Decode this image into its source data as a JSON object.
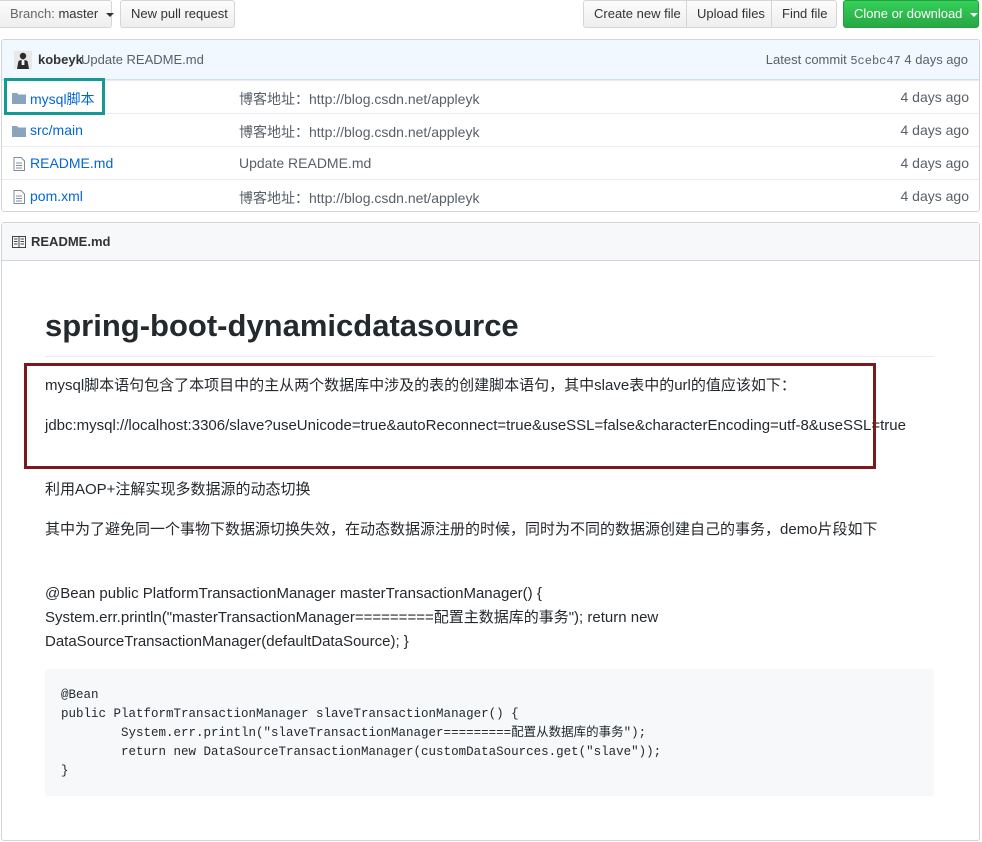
{
  "toolbar": {
    "branch_prefix": "Branch:",
    "branch_name": "master",
    "new_pull_request": "New pull request",
    "create_new_file": "Create new file",
    "upload_files": "Upload files",
    "find_file": "Find file",
    "clone_or_download": "Clone or download"
  },
  "commit": {
    "author": "kobeyk",
    "message": "Update README.md",
    "latest_label": "Latest commit",
    "sha": "5cebc47",
    "age": "4 days ago"
  },
  "files": [
    {
      "name": "mysql脚本",
      "type": "folder",
      "message": "博客地址：http://blog.csdn.net/appleyk",
      "age": "4 days ago"
    },
    {
      "name": "src/main",
      "type": "folder",
      "message": "博客地址：http://blog.csdn.net/appleyk",
      "age": "4 days ago"
    },
    {
      "name": "README.md",
      "type": "file",
      "message": "Update README.md",
      "age": "4 days ago"
    },
    {
      "name": "pom.xml",
      "type": "file",
      "message": "博客地址：http://blog.csdn.net/appleyk",
      "age": "4 days ago"
    }
  ],
  "readme": {
    "header": "README.md",
    "title": "spring-boot-dynamicdatasource",
    "p1": "mysql脚本语句包含了本项目中的主从两个数据库中涉及的表的创建脚本语句，其中slave表中的url的值应该如下：",
    "p2": "jdbc:mysql://localhost:3306/slave?useUnicode=true&autoReconnect=true&useSSL=false&characterEncoding=utf-8&useSSL=true",
    "p3": "利用AOP+注解实现多数据源的动态切换",
    "p4": "其中为了避免同一个事物下数据源切换失效，在动态数据源注册的时候，同时为不同的数据源创建自己的事务，demo片段如下",
    "p5": "@Bean public PlatformTransactionManager masterTransactionManager() { System.err.println(\"masterTransactionManager=========配置主数据库的事务\"); return new DataSourceTransactionManager(defaultDataSource); }",
    "code": "@Bean\npublic PlatformTransactionManager slaveTransactionManager() {\n        System.err.println(\"slaveTransactionManager=========配置从数据库的事务\");\n        return new DataSourceTransactionManager(customDataSources.get(\"slave\"));\n}"
  },
  "colors": {
    "link": "#0366d6",
    "clone_green": "#28a745",
    "highlight_teal": "#139a95",
    "highlight_red": "#7a1a1f"
  }
}
